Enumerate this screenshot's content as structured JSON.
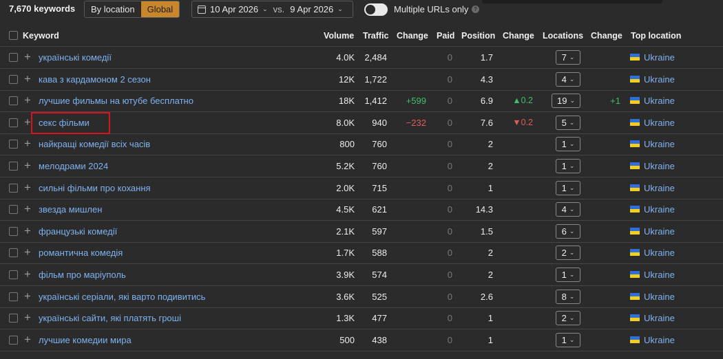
{
  "toolbar": {
    "keyword_count": "7,670 keywords",
    "seg_by_location": "By location",
    "seg_global": "Global",
    "date_from": "10 Apr 2026",
    "vs": "vs.",
    "date_to": "9 Apr 2026",
    "multiple_urls_label": "Multiple URLs only",
    "help": "?"
  },
  "table": {
    "headers": {
      "keyword": "Keyword",
      "volume": "Volume",
      "traffic": "Traffic",
      "change": "Change",
      "paid": "Paid",
      "position": "Position",
      "pos_change": "Change",
      "locations": "Locations",
      "loc_change": "Change",
      "top_location": "Top location"
    },
    "rows": [
      {
        "keyword": "українські комедії",
        "volume": "4.0K",
        "traffic": "2,484",
        "change": "",
        "paid": "0",
        "position": "1.7",
        "pos_change": "",
        "locations": "7",
        "loc_change": "",
        "top_location": "Ukraine"
      },
      {
        "keyword": "кава з кардамоном 2 сезон",
        "volume": "12K",
        "traffic": "1,722",
        "change": "",
        "paid": "0",
        "position": "4.3",
        "pos_change": "",
        "locations": "4",
        "loc_change": "",
        "top_location": "Ukraine"
      },
      {
        "keyword": "лучшие фильмы на ютубе бесплатно",
        "volume": "18K",
        "traffic": "1,412",
        "change": "+599",
        "paid": "0",
        "position": "6.9",
        "pos_change": "▲0.2",
        "locations": "19",
        "loc_change": "+1",
        "top_location": "Ukraine"
      },
      {
        "keyword": "секс фільми",
        "volume": "8.0K",
        "traffic": "940",
        "change": "−232",
        "paid": "0",
        "position": "7.6",
        "pos_change": "▼0.2",
        "locations": "5",
        "loc_change": "",
        "top_location": "Ukraine"
      },
      {
        "keyword": "найкращі комедії всіх часів",
        "volume": "800",
        "traffic": "760",
        "change": "",
        "paid": "0",
        "position": "2",
        "pos_change": "",
        "locations": "1",
        "loc_change": "",
        "top_location": "Ukraine"
      },
      {
        "keyword": "мелодрами 2024",
        "volume": "5.2K",
        "traffic": "760",
        "change": "",
        "paid": "0",
        "position": "2",
        "pos_change": "",
        "locations": "1",
        "loc_change": "",
        "top_location": "Ukraine"
      },
      {
        "keyword": "сильні фільми про кохання",
        "volume": "2.0K",
        "traffic": "715",
        "change": "",
        "paid": "0",
        "position": "1",
        "pos_change": "",
        "locations": "1",
        "loc_change": "",
        "top_location": "Ukraine"
      },
      {
        "keyword": "звезда мишлен",
        "volume": "4.5K",
        "traffic": "621",
        "change": "",
        "paid": "0",
        "position": "14.3",
        "pos_change": "",
        "locations": "4",
        "loc_change": "",
        "top_location": "Ukraine"
      },
      {
        "keyword": "французькі комедії",
        "volume": "2.1K",
        "traffic": "597",
        "change": "",
        "paid": "0",
        "position": "1.5",
        "pos_change": "",
        "locations": "6",
        "loc_change": "",
        "top_location": "Ukraine"
      },
      {
        "keyword": "романтична комедія",
        "volume": "1.7K",
        "traffic": "588",
        "change": "",
        "paid": "0",
        "position": "2",
        "pos_change": "",
        "locations": "2",
        "loc_change": "",
        "top_location": "Ukraine"
      },
      {
        "keyword": "фільм про маріуполь",
        "volume": "3.9K",
        "traffic": "574",
        "change": "",
        "paid": "0",
        "position": "2",
        "pos_change": "",
        "locations": "1",
        "loc_change": "",
        "top_location": "Ukraine"
      },
      {
        "keyword": "українські серіали, які варто подивитись",
        "volume": "3.6K",
        "traffic": "525",
        "change": "",
        "paid": "0",
        "position": "2.6",
        "pos_change": "",
        "locations": "8",
        "loc_change": "",
        "top_location": "Ukraine"
      },
      {
        "keyword": "українські сайти, які платять гроші",
        "volume": "1.3K",
        "traffic": "477",
        "change": "",
        "paid": "0",
        "position": "1",
        "pos_change": "",
        "locations": "2",
        "loc_change": "",
        "top_location": "Ukraine"
      },
      {
        "keyword": "лучшие комедии мира",
        "volume": "500",
        "traffic": "438",
        "change": "",
        "paid": "0",
        "position": "1",
        "pos_change": "",
        "locations": "1",
        "loc_change": "",
        "top_location": "Ukraine"
      }
    ]
  },
  "colors": {
    "accent": "#c9862a",
    "link": "#7fb2f0",
    "positive": "#3fbf6a",
    "negative": "#e35b5b",
    "highlight_box": "#d8141e"
  }
}
